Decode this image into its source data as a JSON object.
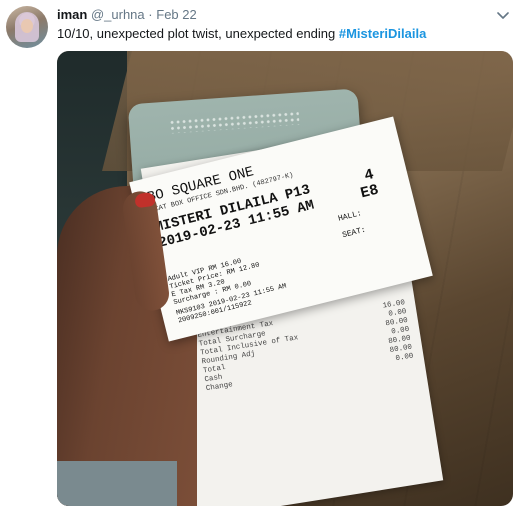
{
  "tweet": {
    "name": "iman",
    "handle": "@_urhna",
    "separator": "·",
    "date": "Feb 22",
    "text": "10/10, unexpected plot twist, unexpected ending ",
    "hashtag": "#MisteriDilaila"
  },
  "photo": {
    "ticket": {
      "cinema": "BO SQUARE ONE",
      "company": "NCAT BOX OFFICE SDN.BHD. (482797-K)",
      "movie": "MISTERI DILAILA P13",
      "showtime": "2019-02-23 11:55 AM",
      "hall_number": "4",
      "seat_number": "E8",
      "hall_label": "HALL:",
      "seat_label": "SEAT:",
      "price_lines": [
        "Adult VIP  RM 16.00",
        "Ticket Price:  RM 12.80",
        "E Tax         RM  3.20",
        "Surcharge :   RM  0.00"
      ],
      "code_lines": [
        "MKS9103          2019-02-23 11:55 AM",
        "2009250:001/115922"
      ]
    },
    "receipt": {
      "lines": [
        [
          "Entertainment Tax",
          "16.00"
        ],
        [
          "Total Surcharge",
          "0.00"
        ],
        [
          "Total Inclusive of Tax",
          "80.00"
        ],
        [
          "Rounding Adj",
          "0.00"
        ],
        [
          "Total",
          "80.00"
        ],
        [
          "Cash",
          "80.00"
        ],
        [
          "Change",
          "0.00"
        ]
      ]
    }
  },
  "colors": {
    "hashtag": "#1b95e0",
    "muted": "#657786"
  },
  "icons": {
    "caret": "chevron-down-icon"
  }
}
